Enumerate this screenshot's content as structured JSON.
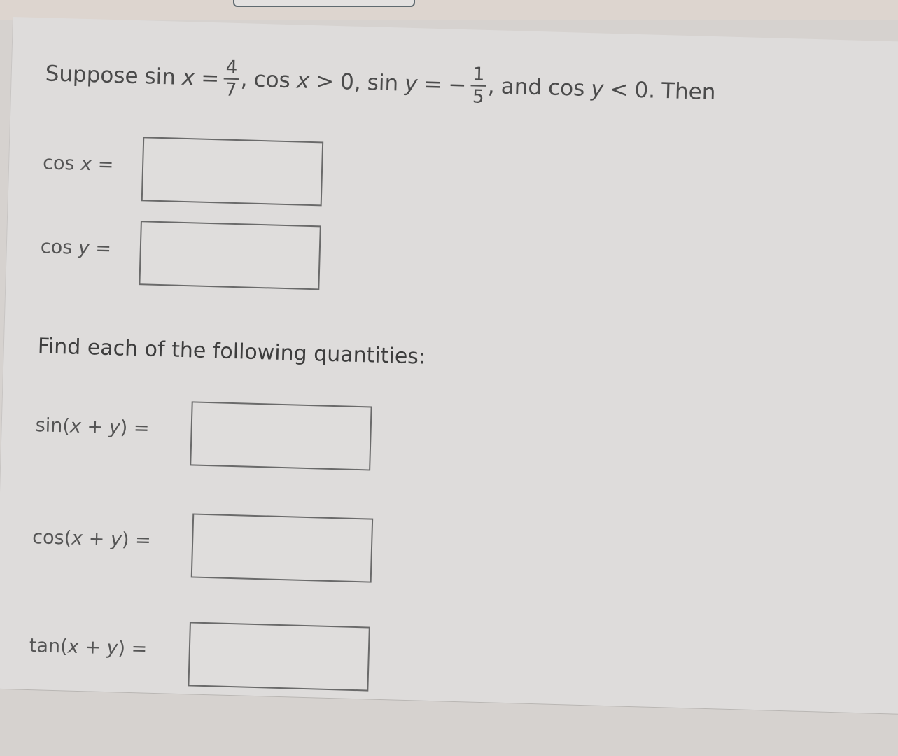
{
  "problem": {
    "intro": "Suppose",
    "sin_x": {
      "func": "sin",
      "var": "x",
      "eq": "=",
      "numerator": "4",
      "denominator": "7",
      "sign": ""
    },
    "cond_x": {
      "func": "cos",
      "var": "x",
      "rel": ">",
      "value": "0"
    },
    "sin_y": {
      "func": "sin",
      "var": "y",
      "eq": "=",
      "numerator": "1",
      "denominator": "5",
      "sign": "−"
    },
    "cond_y": {
      "prefix": "and",
      "func": "cos",
      "var": "y",
      "rel": "<",
      "value": "0."
    },
    "outro": "Then",
    "comma": ","
  },
  "first_answers": [
    {
      "func": "cos",
      "var": "x",
      "eq": "=",
      "value": "",
      "placeholder": ""
    },
    {
      "func": "cos",
      "var": "y",
      "eq": "=",
      "value": "",
      "placeholder": ""
    }
  ],
  "instruction": "Find each of the following quantities:",
  "second_answers": [
    {
      "func": "sin",
      "open": "(",
      "var1": "x",
      "op": "+",
      "var2": "y",
      "close": ")",
      "eq": "=",
      "value": "",
      "placeholder": ""
    },
    {
      "func": "cos",
      "open": "(",
      "var1": "x",
      "op": "+",
      "var2": "y",
      "close": ")",
      "eq": "=",
      "value": "",
      "placeholder": ""
    },
    {
      "func": "tan",
      "open": "(",
      "var1": "x",
      "op": "+",
      "var2": "y",
      "close": ")",
      "eq": "=",
      "value": "",
      "placeholder": ""
    }
  ]
}
